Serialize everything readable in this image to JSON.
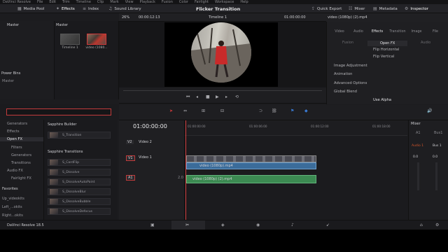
{
  "menubar": {
    "items": [
      "DaVinci Resolve",
      "File",
      "Edit",
      "Trim",
      "Timeline",
      "Clip",
      "Mark",
      "View",
      "Playback",
      "Fusion",
      "Color",
      "Fairlight",
      "Workspace",
      "Help"
    ]
  },
  "toolbar": {
    "media_pool": "Media Pool",
    "effects": "Effects",
    "index": "Index",
    "sound_library": "Sound Library",
    "project_title": "Flicker Transition",
    "quick_export": "Quick Export",
    "mixer": "Mixer",
    "metadata": "Metadata",
    "inspector": "Inspector"
  },
  "viewer": {
    "zoom": "26%",
    "timecode": "00:00:12:13",
    "timeline_name": "Timeline 1",
    "current_timecode": "01:00:00:00"
  },
  "media_pool": {
    "bin": "Master",
    "header": "Master",
    "power_bins": "Power Bins",
    "power_master": "Master",
    "thumb1": "Timeline 1",
    "thumb2": "video (1080..."
  },
  "inspector": {
    "clip": "video (1080p) (2).mp4",
    "tabs": [
      "Video",
      "Audio",
      "Effects",
      "Transition",
      "Image",
      "File"
    ],
    "active_tab": "Effects",
    "subtabs": [
      "Fusion",
      "Open FX",
      "Audio"
    ],
    "rows": [
      "Flip Horizontal",
      "Flip Vertical",
      "Image Adjustment",
      "Animation",
      "Advanced Options",
      "Global Blend",
      "Use Alpha"
    ]
  },
  "effects_library": {
    "items": [
      "Generators",
      "Effects",
      "Open FX",
      "Filters",
      "Generators",
      "Transitions",
      "Audio FX",
      "Fairlight FX"
    ],
    "favorites_header": "Favorites",
    "favorites": [
      "Up_videokits",
      "Left_...okits",
      "Right...okits"
    ]
  },
  "sapphire": {
    "builder_header": "Sapphire Builder",
    "builder_item": "S_Transition",
    "transitions_header": "Sapphire Transitions",
    "items": [
      "S_CardFlip",
      "S_Dissolve",
      "S_DissolveAutoPaint",
      "S_DissolveBlur",
      "S_DissolveBubble",
      "S_DissolveDefocus"
    ]
  },
  "timeline": {
    "timecode": "01:00:00:00",
    "ruler": [
      "01:00:00:00",
      "01:00:06:00",
      "01:00:12:00",
      "01:00:18:00"
    ],
    "tracks": [
      {
        "id": "V2",
        "name": "Video 2"
      },
      {
        "id": "V1",
        "name": "Video 1"
      },
      {
        "id": "A1",
        "name": "",
        "level": "2.0"
      }
    ],
    "video_clip": "video (1080p).mp4",
    "audio_clip": "video (1080p) (2).mp4"
  },
  "mixer": {
    "title": "Mixer",
    "a1": "A1",
    "bus1": "Bus1",
    "audio1": "Audio 1",
    "bus1b": "Bus 1",
    "v1": "0.0",
    "v2": "0.0"
  },
  "status": {
    "app": "DaVinci Resolve 18.5"
  },
  "colors": {
    "accent_red": "#d23b3b",
    "video_clip": "#3b6c9a",
    "audio_clip": "#3c8a52"
  }
}
